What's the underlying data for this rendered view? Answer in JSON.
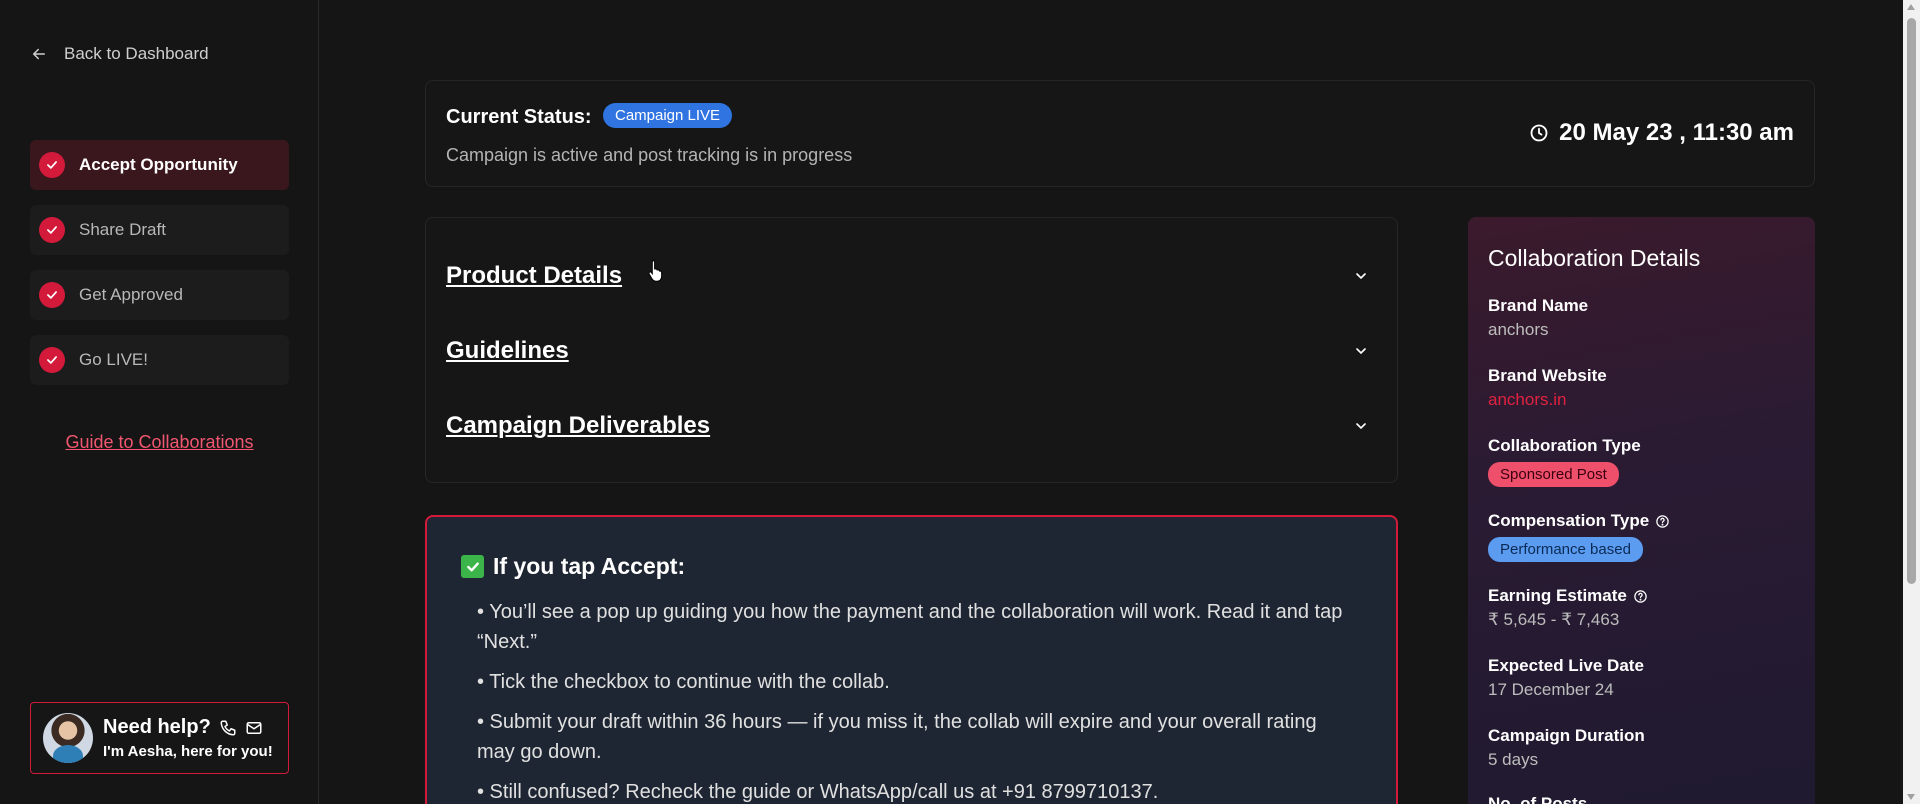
{
  "sidebar": {
    "back_label": "Back to Dashboard",
    "steps": [
      {
        "label": "Accept Opportunity",
        "active": true
      },
      {
        "label": "Share Draft",
        "active": false
      },
      {
        "label": "Get Approved",
        "active": false
      },
      {
        "label": "Go LIVE!",
        "active": false
      }
    ],
    "guide_label": "Guide to Collaborations",
    "help": {
      "title": "Need help?",
      "subtitle": "I'm Aesha, here for you!"
    }
  },
  "status": {
    "label": "Current Status:",
    "badge": "Campaign LIVE",
    "description": "Campaign is active and post tracking is in progress",
    "datetime": "20 May 23 , 11:30 am"
  },
  "accordion": {
    "items": [
      {
        "title": "Product Details"
      },
      {
        "title": "Guidelines"
      },
      {
        "title": "Campaign Deliverables"
      }
    ]
  },
  "accept": {
    "heading": "If you tap Accept:",
    "items": [
      "• You’ll see a pop up guiding you how the payment and the collaboration will work. Read it and tap “Next.”",
      "• Tick the checkbox to continue with the collab.",
      "• Submit your draft within 36 hours — if you miss it, the collab will expire and your overall rating may go down.",
      "• Still confused? Recheck the guide or WhatsApp/call us at +91 8799710137."
    ]
  },
  "collab": {
    "title": "Collaboration Details",
    "brand_name_label": "Brand Name",
    "brand_name": "anchors",
    "brand_website_label": "Brand Website",
    "brand_website": "anchors.in",
    "collab_type_label": "Collaboration Type",
    "collab_type": "Sponsored Post",
    "comp_type_label": "Compensation Type",
    "comp_type": "Performance based",
    "earning_label": "Earning Estimate",
    "earning": "₹ 5,645 - ₹ 7,463",
    "live_date_label": "Expected Live Date",
    "live_date": "17 December 24",
    "duration_label": "Campaign Duration",
    "duration": "5 days",
    "posts_label": "No. of Posts"
  },
  "colors": {
    "accent": "#d31a3b",
    "live_badge": "#2f74e0",
    "background": "#151515"
  }
}
